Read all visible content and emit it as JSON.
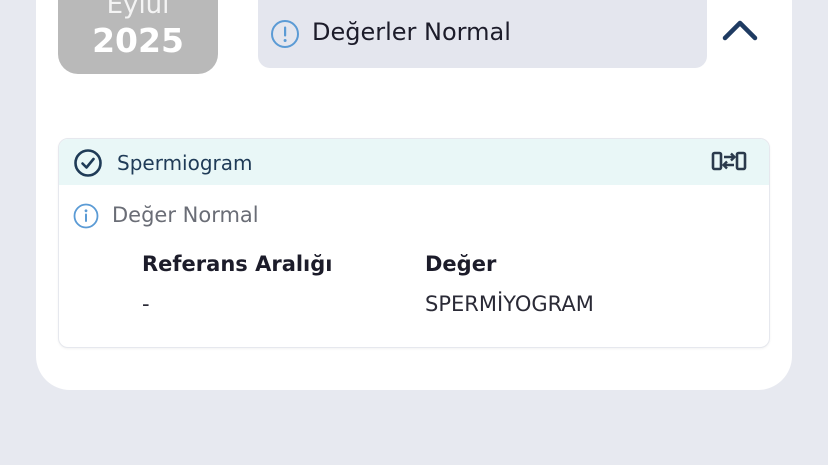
{
  "date": {
    "month": "Eylül",
    "year": "2025"
  },
  "status": {
    "icon": "exclamation-circle-icon",
    "text": "Değerler Normal",
    "collapse_icon": "chevron-up-icon"
  },
  "result": {
    "test_name": "Spermiogram",
    "header_icon": "check-circle-icon",
    "compare_icon": "compare-arrows-icon",
    "normal_text": "Değer Normal",
    "columns": [
      {
        "label": "Referans Aralığı",
        "value": "-"
      },
      {
        "label": "Değer",
        "value": "SPERMİYOGRAM"
      }
    ]
  },
  "colors": {
    "background": "#e7e9f0",
    "badge": "#b9b9b9",
    "pill": "#e4e6ee",
    "header": "#e9f7f7",
    "accent": "#1f3b57",
    "info_blue": "#5b9bd5"
  }
}
